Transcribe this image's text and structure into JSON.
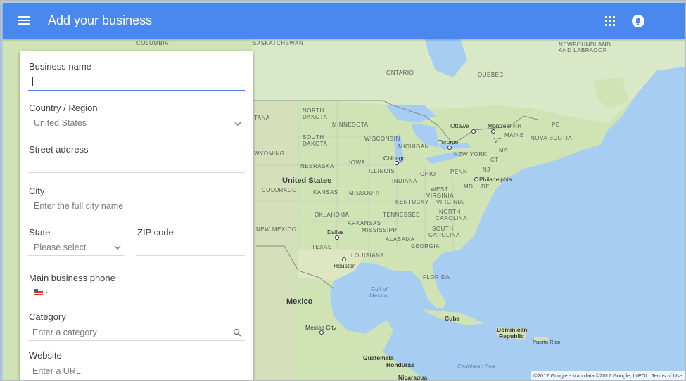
{
  "appbar": {
    "title": "Add your business",
    "menu_icon": "hamburger-menu-icon",
    "apps_icon": "apps-grid-icon",
    "account_icon": "account-icon"
  },
  "form": {
    "business_name": {
      "label": "Business name",
      "value": ""
    },
    "country": {
      "label": "Country / Region",
      "value": "United States"
    },
    "street": {
      "label": "Street address",
      "value": ""
    },
    "city": {
      "label": "City",
      "placeholder": "Enter the full city name"
    },
    "state": {
      "label": "State",
      "placeholder": "Please select"
    },
    "zip": {
      "label": "ZIP code",
      "value": ""
    },
    "phone": {
      "label": "Main business phone",
      "flag_icon": "us-flag-icon"
    },
    "category": {
      "label": "Category",
      "placeholder": "Enter a category"
    },
    "website": {
      "label": "Website",
      "placeholder": "Enter a URL"
    }
  },
  "map": {
    "regions": [
      "COLUMBIA",
      "SASKATCHEWAN",
      "NEWFOUNDLAND",
      "AND LABRADOR",
      "ONTARIO",
      "QUÉBEC",
      "NORTH",
      "DAKOTA",
      "TANA",
      "MINNESOTA",
      "SOUTH",
      "DAKOTA",
      "WISCONSIN",
      "MICHIGAN",
      "NH",
      "MAINE",
      "PE",
      "NOVA SCOTIA",
      "VT",
      "NEW YORK",
      "MA",
      "CT",
      "WYOMING",
      "NEBRASKA",
      "IOWA",
      "ILLINOIS",
      "OHIO",
      "PENN",
      "NJ",
      "COLORADO",
      "KANSAS",
      "MISSOURI",
      "INDIANA",
      "WEST",
      "VIRGINIA",
      "DE",
      "MD",
      "KENTUCKY",
      "VIRGINIA",
      "TENNESSEE",
      "NORTH",
      "CAROLINA",
      "OKLAHOMA",
      "ARKANSAS",
      "SOUTH",
      "CAROLINA",
      "NEW MEXICO",
      "MISSISSIPPI",
      "ALABAMA",
      "GEORGIA",
      "TEXAS",
      "LOUISIANA",
      "FLORIDA"
    ],
    "cities": [
      "Ottawa",
      "Montreal",
      "Toronto",
      "Chicago",
      "Philadelphia",
      "Dallas",
      "Houston",
      "Mexico City"
    ],
    "countries": [
      "United States",
      "Mexico",
      "Cuba",
      "Dominican",
      "Republic",
      "Puerto Rico",
      "Guatemala",
      "Honduras",
      "Nicaragua"
    ],
    "water": [
      "Gulf of",
      "Mexico",
      "Caribbean Sea"
    ],
    "attribution": "©2017 Google - Map data ©2017 Google, INEGI",
    "terms": "Terms of Use"
  },
  "colors": {
    "appbar": "#4a87ee",
    "water": "#a7cdf2",
    "land": "#cfe3b5"
  }
}
